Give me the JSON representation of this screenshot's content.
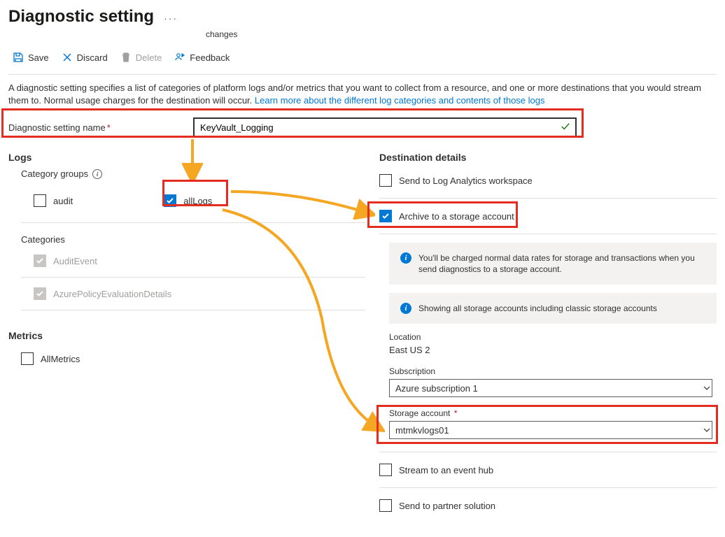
{
  "header": {
    "title": "Diagnostic setting",
    "changes": "changes"
  },
  "toolbar": {
    "save": "Save",
    "discard": "Discard",
    "delete": "Delete",
    "feedback": "Feedback"
  },
  "intro": {
    "text": "A diagnostic setting specifies a list of categories of platform logs and/or metrics that you want to collect from a resource, and one or more destinations that you would stream them to. Normal usage charges for the destination will occur. ",
    "link": "Learn more about the different log categories and contents of those logs"
  },
  "nameRow": {
    "label": "Diagnostic setting name",
    "value": "KeyVault_Logging"
  },
  "logs": {
    "heading": "Logs",
    "categoryGroups": "Category groups",
    "audit": "audit",
    "allLogs": "allLogs",
    "categories": "Categories",
    "auditEvent": "AuditEvent",
    "azurePolicy": "AzurePolicyEvaluationDetails"
  },
  "metrics": {
    "heading": "Metrics",
    "allMetrics": "AllMetrics"
  },
  "dest": {
    "heading": "Destination details",
    "law": "Send to Log Analytics workspace",
    "archive": "Archive to a storage account",
    "info1": "You'll be charged normal data rates for storage and transactions when you send diagnostics to a storage account.",
    "info2": "Showing all storage accounts including classic storage accounts",
    "location": {
      "label": "Location",
      "value": "East US 2"
    },
    "subscription": {
      "label": "Subscription",
      "value": "Azure subscription 1"
    },
    "storage": {
      "label": "Storage account",
      "value": "mtmkvlogs01"
    },
    "eventhub": "Stream to an event hub",
    "partner": "Send to partner solution"
  }
}
